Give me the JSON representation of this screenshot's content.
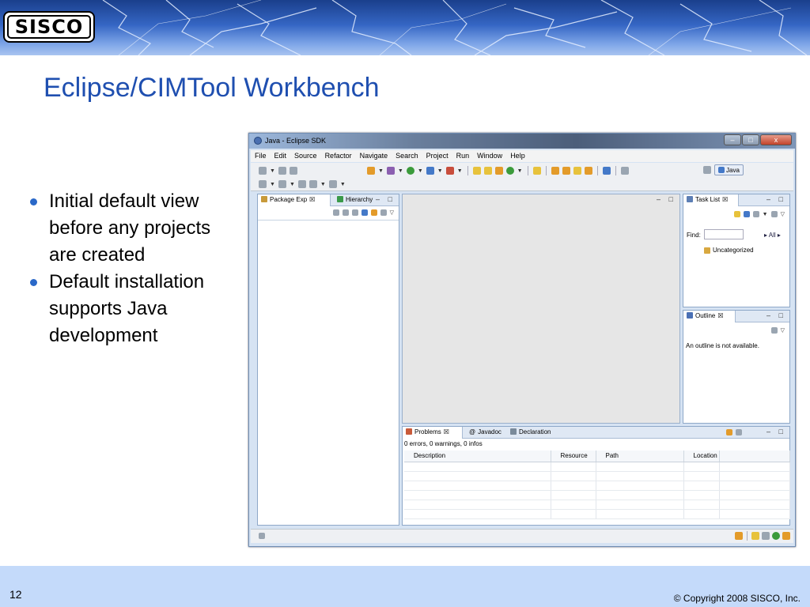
{
  "slide": {
    "title": "Eclipse/CIMTool Workbench",
    "logo_text": "SISCO",
    "bullets": [
      "Initial default view before any projects are created",
      "Default installation supports Java development"
    ],
    "page_number": "12",
    "copyright": "© Copyright 2008 SISCO, Inc."
  },
  "eclipse": {
    "window_title": "Java - Eclipse SDK",
    "window_buttons": {
      "minimize": "–",
      "maximize": "□",
      "close": "x"
    },
    "menu": [
      "File",
      "Edit",
      "Source",
      "Refactor",
      "Navigate",
      "Search",
      "Project",
      "Run",
      "Window",
      "Help"
    ],
    "perspective_label": "Java",
    "left_panel": {
      "tabs": [
        "Package Exp",
        "Hierarchy"
      ],
      "controls": "– □"
    },
    "editor_controls": "– □",
    "task_list": {
      "tab": "Task List",
      "find_label": "Find:",
      "all_label": "All",
      "category": "Uncategorized",
      "controls": "– □"
    },
    "outline": {
      "tab": "Outline",
      "message": "An outline is not available.",
      "controls": "– □"
    },
    "problems": {
      "tabs": [
        "Problems",
        "Javadoc",
        "Declaration"
      ],
      "summary": "0 errors, 0 warnings, 0 infos",
      "columns": [
        "Description",
        "Resource",
        "Path",
        "Location"
      ],
      "empty_rows": 6,
      "controls": "– □"
    },
    "icon_colors": {
      "package": "#c89a3a",
      "hierarchy": "#3a9a4a",
      "tasklist": "#5d7fb5",
      "outline": "#4a70b5",
      "problems": "#c85a3a",
      "javadoc": "#4a70b5",
      "declaration": "#7a8a9a"
    }
  }
}
